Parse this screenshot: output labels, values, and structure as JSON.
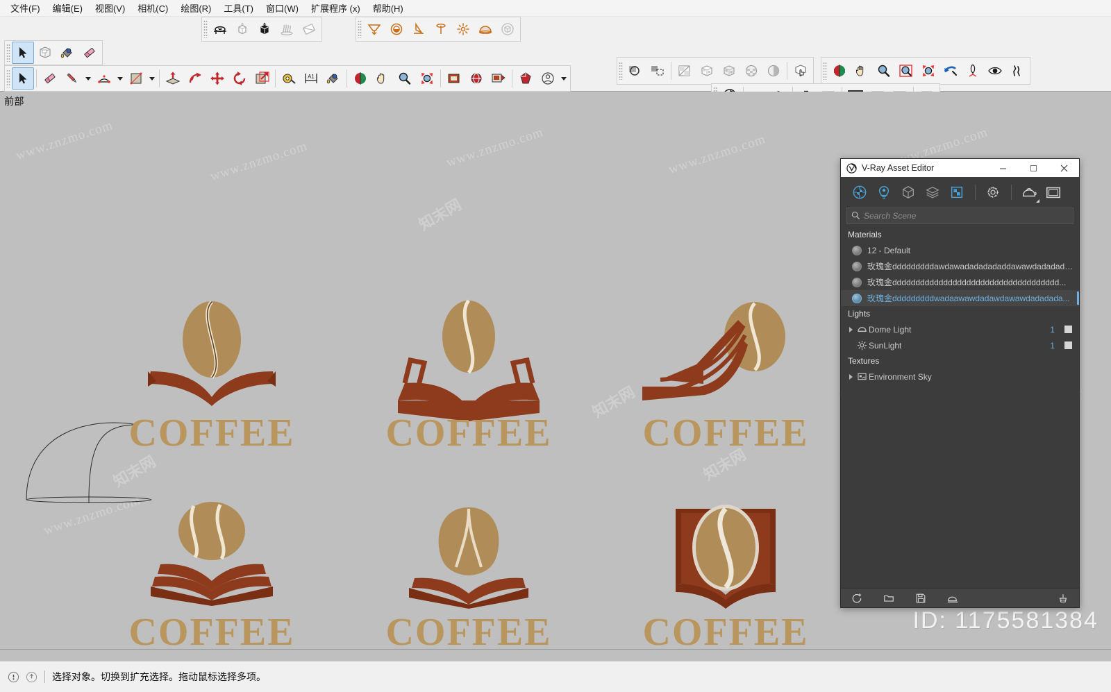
{
  "menu": {
    "items": [
      {
        "label": "文件(F)",
        "name": "menu-file"
      },
      {
        "label": "编辑(E)",
        "name": "menu-edit"
      },
      {
        "label": "视图(V)",
        "name": "menu-view"
      },
      {
        "label": "相机(C)",
        "name": "menu-camera"
      },
      {
        "label": "绘图(R)",
        "name": "menu-draw"
      },
      {
        "label": "工具(T)",
        "name": "menu-tools"
      },
      {
        "label": "窗口(W)",
        "name": "menu-window"
      },
      {
        "label": "扩展程序 (x)",
        "name": "menu-extensions"
      },
      {
        "label": "帮助(H)",
        "name": "menu-help"
      }
    ]
  },
  "toolbars": {
    "principal": [
      "select-icon",
      "make-component-icon",
      "paint-bucket-icon",
      "eraser-icon"
    ],
    "vray_objects": [
      "vray-infinite-plane-icon",
      "vray-proxy-icon",
      "vray-proxy-preview-icon",
      "vray-fur-icon",
      "vray-clipper-icon"
    ],
    "vray_lights": [
      "vray-rect-light-icon",
      "vray-sphere-light-icon",
      "vray-spot-light-icon",
      "vray-ies-light-icon",
      "vray-omni-light-icon",
      "vray-dome-light-icon",
      "vray-mesh-light-icon"
    ],
    "styles": [
      "xray-icon",
      "back-edges-icon",
      "wireframe-icon",
      "hidden-line-icon",
      "shaded-icon",
      "shaded-texture-icon",
      "monochrome-icon",
      "section-display-icon"
    ],
    "camera": [
      "orbit-icon",
      "pan-icon",
      "zoom-icon",
      "zoom-window-icon",
      "zoom-extents-icon",
      "previous-view-icon",
      "position-camera-icon",
      "look-around-icon",
      "walk-icon"
    ],
    "drawing": [
      "select-icon",
      "eraser-icon",
      "line-icon",
      "arc-icon",
      "rectangle-icon",
      "push-pull-icon",
      "follow-me-icon",
      "move-icon",
      "rotate-icon",
      "scale-icon",
      "tape-measure-icon",
      "dimension-icon",
      "paint-bucket-icon",
      "orbit-icon",
      "pan-icon",
      "zoom-icon",
      "zoom-extents-icon",
      "section-plane-icon",
      "add-location-icon",
      "photo-texture-icon",
      "3d-warehouse-icon",
      "account-icon"
    ],
    "vray_render": [
      "vray-asset-editor-icon",
      "vray-render-icon",
      "vray-render-interactive-icon",
      "vray-render-last-icon",
      "vray-render-region-icon",
      "vray-frame-buffer-icon",
      "vray-batch-render-icon",
      "vray-cloud-icon",
      "vray-lock-icon"
    ]
  },
  "viewport": {
    "label": "前部",
    "background": "#bfbfbf",
    "watermarks": [
      "www.znzmo.com",
      "知末网",
      "www.znzmo.com",
      "知末网",
      "www.znzmo.com",
      "知末网",
      "www.znzmo.com",
      "知末网",
      "www.znzmo.com",
      "知末网",
      "www.znzmo.com"
    ],
    "brand_watermark": "知末",
    "id_watermark": "ID: 1175581384",
    "logos": [
      {
        "name": "logo-bean-over-book-1",
        "caption": "COFFEE",
        "style": "bean-above-open-book-thin"
      },
      {
        "name": "logo-bean-over-book-2",
        "caption": "COFFEE",
        "style": "bean-above-open-book-outline"
      },
      {
        "name": "logo-book-left-bean-right",
        "caption": "COFFEE",
        "style": "book-left-bean-right"
      },
      {
        "name": "logo-bean-book-layered",
        "caption": "COFFEE",
        "style": "bean-above-layered-book"
      },
      {
        "name": "logo-bean-wide-book",
        "caption": "COFFEE",
        "style": "wide-bean-above-book"
      },
      {
        "name": "logo-solid-book-bean",
        "caption": "COFFEE",
        "style": "solid-book-with-bean"
      }
    ],
    "colors": {
      "bean": "#b08d58",
      "bean_dark": "#8f6f3f",
      "book": "#8e3b1d",
      "book_dark": "#7a2f14",
      "text": "#b9965e"
    }
  },
  "vray_panel": {
    "title": "V-Ray Asset Editor",
    "window_buttons": [
      "minimize-button",
      "maximize-button",
      "close-button"
    ],
    "tabs": [
      {
        "name": "tab-materials",
        "icon": "material-sphere-icon",
        "active": true
      },
      {
        "name": "tab-lights",
        "icon": "light-bulb-icon",
        "active": false
      },
      {
        "name": "tab-geometry",
        "icon": "cube-icon",
        "active": false
      },
      {
        "name": "tab-render-elements",
        "icon": "layers-icon",
        "active": false
      },
      {
        "name": "tab-textures",
        "icon": "texture-square-icon",
        "active": true
      },
      {
        "name": "tab-settings",
        "icon": "gear-icon",
        "active": false
      },
      {
        "name": "tab-render",
        "icon": "teapot-icon",
        "active": false
      },
      {
        "name": "tab-frame-buffer",
        "icon": "frame-buffer-icon",
        "active": false
      }
    ],
    "search": {
      "placeholder": "Search Scene",
      "value": ""
    },
    "sections": {
      "materials_header": "Materials",
      "lights_header": "Lights",
      "textures_header": "Textures"
    },
    "materials": [
      {
        "name": "12 - Default",
        "selected": false
      },
      {
        "name": "玫瑰金dddddddddawdawadadadadaddawawdadadada...",
        "selected": false
      },
      {
        "name": "玫瑰金dddddddddddddddddddddddddddddddddddd...",
        "selected": false
      },
      {
        "name": "玫瑰金dddddddddwadaawawdadawdawawdadadada...",
        "selected": true
      }
    ],
    "lights": [
      {
        "name": "Dome Light",
        "count": "1",
        "icon": "dome-light-icon",
        "expandable": true,
        "enabled": true
      },
      {
        "name": "SunLight",
        "count": "1",
        "icon": "sun-light-icon",
        "expandable": false,
        "enabled": true
      }
    ],
    "textures": [
      {
        "name": "Environment Sky",
        "icon": "sky-texture-icon",
        "expandable": true
      }
    ],
    "footer_buttons": [
      {
        "name": "add-asset-button",
        "icon": "add-circle-icon"
      },
      {
        "name": "open-library-button",
        "icon": "folder-icon"
      },
      {
        "name": "save-asset-button",
        "icon": "floppy-disk-icon"
      },
      {
        "name": "import-button",
        "icon": "import-icon"
      },
      {
        "name": "purge-button",
        "icon": "purge-icon"
      }
    ],
    "accent_color": "#6fb0e0",
    "background_color": "#3c3c3c"
  },
  "statusbar": {
    "message": "选择对象。切换到扩充选择。拖动鼠标选择多项。",
    "icons": [
      "info-icon",
      "context-help-icon"
    ]
  }
}
